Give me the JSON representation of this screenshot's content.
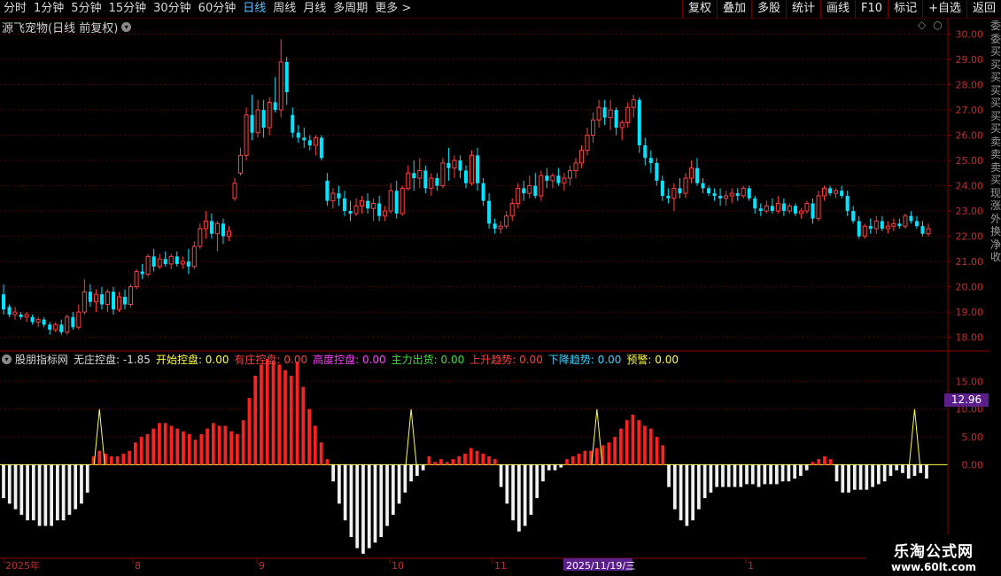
{
  "toolbar": {
    "periods": [
      "分时",
      "1分钟",
      "5分钟",
      "15分钟",
      "30分钟",
      "60分钟",
      "日线",
      "周线",
      "月线",
      "多周期",
      "更多 >"
    ],
    "active_period": "日线",
    "buttons": [
      "复权",
      "叠加",
      "多股",
      "统计",
      "画线",
      "F10",
      "标记",
      "+自选",
      "返回"
    ]
  },
  "chart_title": "源飞宠物(日线 前复权)",
  "price_axis": [
    "30.00",
    "29.00",
    "28.00",
    "27.00",
    "26.00",
    "25.00",
    "24.00",
    "23.00",
    "22.00",
    "21.00",
    "20.00",
    "19.00",
    "18.00"
  ],
  "indicator": {
    "name": "股朋指标网",
    "items": [
      {
        "label": "无庄控盘:",
        "value": "-1.85",
        "color": "#d8d8d8"
      },
      {
        "label": "开始控盘:",
        "value": "0.00",
        "color": "#ffff40"
      },
      {
        "label": "有庄控盘:",
        "value": "0.00",
        "color": "#ff4040"
      },
      {
        "label": "高度控盘:",
        "value": "0.00",
        "color": "#ff40ff"
      },
      {
        "label": "主力出货:",
        "value": "0.00",
        "color": "#40e040"
      },
      {
        "label": "上升趋势:",
        "value": "0.00",
        "color": "#ff4040"
      },
      {
        "label": "下降趋势:",
        "value": "0.00",
        "color": "#40d0ff"
      },
      {
        "label": "预警:",
        "value": "0.00",
        "color": "#ffff40"
      }
    ],
    "axis": [
      "15.00",
      "10.00",
      "5.00",
      "0.00"
    ],
    "current_value": "12.96"
  },
  "date_axis": [
    "2025年",
    "8",
    "9",
    "10",
    "11",
    "2025/11/19/三",
    "1"
  ],
  "right_strip": [
    "委",
    "委",
    "买",
    "买",
    "买",
    "买",
    "买",
    "买",
    "买",
    "卖",
    "卖",
    "卖",
    "买",
    "现",
    "涨",
    "外",
    "换",
    "净",
    "收"
  ],
  "watermark": {
    "line1": "乐淘公式网",
    "line2": "www.60lt.com"
  },
  "chart_data": [
    {
      "type": "candlestick",
      "title": "源飞宠物(日线 前复权)",
      "ylim": [
        17.6,
        30.3
      ],
      "colors": {
        "up": "#ff4040",
        "down": "#00e5ff"
      },
      "ohlc": [
        [
          19.7,
          20.1,
          18.9,
          19.1
        ],
        [
          19.2,
          19.3,
          18.8,
          18.9
        ],
        [
          18.9,
          19.2,
          18.7,
          19.0
        ],
        [
          18.9,
          19.0,
          18.7,
          18.8
        ],
        [
          18.8,
          19.0,
          18.6,
          18.9
        ],
        [
          18.8,
          18.9,
          18.5,
          18.6
        ],
        [
          18.6,
          18.8,
          18.4,
          18.7
        ],
        [
          18.7,
          18.8,
          18.4,
          18.5
        ],
        [
          18.5,
          18.6,
          18.1,
          18.3
        ],
        [
          18.3,
          18.6,
          18.2,
          18.5
        ],
        [
          18.5,
          18.7,
          18.1,
          18.2
        ],
        [
          18.2,
          18.9,
          18.1,
          18.8
        ],
        [
          18.8,
          19.0,
          18.3,
          18.4
        ],
        [
          18.4,
          19.3,
          18.3,
          19.0
        ],
        [
          19.0,
          20.3,
          18.9,
          19.8
        ],
        [
          19.8,
          20.1,
          19.2,
          19.4
        ],
        [
          19.4,
          19.9,
          19.0,
          19.7
        ],
        [
          19.7,
          20.0,
          19.1,
          19.3
        ],
        [
          19.3,
          19.9,
          19.0,
          19.8
        ],
        [
          19.8,
          20.0,
          18.9,
          19.1
        ],
        [
          19.1,
          19.8,
          19.0,
          19.6
        ],
        [
          19.6,
          19.9,
          19.1,
          19.3
        ],
        [
          19.3,
          20.1,
          19.2,
          20.0
        ],
        [
          20.0,
          20.7,
          19.9,
          20.6
        ],
        [
          20.6,
          20.9,
          20.3,
          20.5
        ],
        [
          20.5,
          21.3,
          20.4,
          21.2
        ],
        [
          21.2,
          21.5,
          20.6,
          20.8
        ],
        [
          20.8,
          21.3,
          20.7,
          21.1
        ],
        [
          21.1,
          21.4,
          20.8,
          20.9
        ],
        [
          20.9,
          21.3,
          20.7,
          21.2
        ],
        [
          21.2,
          21.4,
          20.8,
          20.9
        ],
        [
          20.9,
          21.2,
          20.7,
          21.0
        ],
        [
          21.0,
          21.5,
          20.5,
          20.8
        ],
        [
          20.8,
          21.8,
          20.7,
          21.6
        ],
        [
          21.6,
          22.5,
          21.5,
          22.3
        ],
        [
          22.3,
          23.0,
          21.9,
          22.6
        ],
        [
          22.6,
          22.9,
          21.9,
          22.1
        ],
        [
          22.1,
          22.6,
          21.4,
          22.5
        ],
        [
          22.5,
          22.7,
          21.7,
          22.0
        ],
        [
          22.0,
          22.4,
          21.8,
          22.2
        ],
        [
          23.5,
          24.3,
          23.4,
          24.1
        ],
        [
          24.5,
          25.5,
          24.4,
          25.2
        ],
        [
          25.2,
          27.1,
          25.0,
          26.8
        ],
        [
          26.8,
          27.6,
          25.8,
          26.1
        ],
        [
          26.1,
          27.4,
          25.9,
          27.0
        ],
        [
          27.0,
          27.4,
          25.9,
          26.3
        ],
        [
          26.3,
          27.5,
          26.0,
          27.3
        ],
        [
          27.3,
          28.3,
          26.9,
          27.0
        ],
        [
          27.0,
          29.8,
          26.7,
          28.9
        ],
        [
          28.9,
          29.1,
          27.2,
          27.7
        ],
        [
          26.8,
          27.1,
          25.9,
          26.1
        ],
        [
          26.1,
          26.4,
          25.7,
          25.9
        ],
        [
          25.9,
          26.3,
          25.5,
          25.8
        ],
        [
          25.8,
          26.0,
          25.4,
          25.6
        ],
        [
          25.6,
          26.0,
          25.2,
          25.9
        ],
        [
          25.9,
          26.0,
          25.0,
          25.1
        ],
        [
          24.2,
          24.5,
          23.2,
          23.4
        ],
        [
          23.4,
          23.9,
          23.1,
          23.7
        ],
        [
          23.7,
          24.0,
          23.2,
          23.5
        ],
        [
          23.5,
          23.8,
          22.8,
          23.0
        ],
        [
          23.0,
          23.4,
          22.6,
          22.9
        ],
        [
          22.9,
          23.5,
          22.8,
          23.2
        ],
        [
          23.2,
          23.6,
          22.9,
          23.4
        ],
        [
          23.4,
          23.7,
          22.9,
          23.1
        ],
        [
          23.1,
          23.5,
          22.6,
          23.3
        ],
        [
          23.3,
          23.6,
          22.6,
          22.8
        ],
        [
          22.8,
          23.2,
          22.6,
          23.0
        ],
        [
          23.0,
          24.1,
          22.9,
          23.8
        ],
        [
          23.8,
          24.2,
          22.7,
          22.9
        ],
        [
          22.9,
          24.0,
          22.8,
          23.9
        ],
        [
          23.9,
          24.8,
          23.8,
          24.5
        ],
        [
          24.5,
          25.0,
          23.8,
          24.3
        ],
        [
          24.3,
          25.1,
          23.9,
          24.6
        ],
        [
          24.6,
          24.8,
          23.7,
          23.9
        ],
        [
          23.9,
          24.5,
          23.6,
          24.3
        ],
        [
          24.3,
          24.5,
          23.8,
          24.0
        ],
        [
          24.0,
          25.1,
          23.9,
          24.9
        ],
        [
          24.9,
          25.5,
          24.2,
          24.7
        ],
        [
          24.7,
          25.2,
          24.3,
          25.0
        ],
        [
          25.0,
          25.2,
          24.3,
          24.6
        ],
        [
          24.6,
          24.8,
          23.9,
          24.1
        ],
        [
          24.1,
          25.4,
          24.0,
          25.2
        ],
        [
          25.2,
          25.5,
          23.8,
          24.1
        ],
        [
          24.1,
          24.3,
          23.2,
          23.4
        ],
        [
          23.4,
          23.7,
          22.3,
          22.5
        ],
        [
          22.5,
          22.7,
          22.1,
          22.3
        ],
        [
          22.3,
          22.6,
          22.1,
          22.4
        ],
        [
          22.4,
          23.0,
          22.3,
          22.8
        ],
        [
          22.8,
          23.5,
          22.6,
          23.3
        ],
        [
          23.3,
          24.1,
          23.1,
          23.9
        ],
        [
          23.9,
          24.2,
          23.4,
          23.7
        ],
        [
          23.7,
          24.4,
          23.5,
          24.0
        ],
        [
          24.0,
          24.5,
          23.5,
          23.6
        ],
        [
          23.6,
          24.6,
          23.4,
          24.4
        ],
        [
          24.4,
          24.7,
          23.9,
          24.2
        ],
        [
          24.2,
          24.5,
          23.9,
          24.4
        ],
        [
          24.4,
          24.7,
          24.0,
          24.1
        ],
        [
          24.1,
          24.5,
          23.8,
          24.3
        ],
        [
          24.3,
          24.8,
          24.0,
          24.6
        ],
        [
          24.6,
          25.1,
          24.3,
          24.9
        ],
        [
          24.9,
          25.6,
          24.7,
          25.4
        ],
        [
          25.4,
          26.3,
          25.2,
          26.0
        ],
        [
          26.0,
          26.9,
          25.7,
          26.6
        ],
        [
          26.6,
          27.4,
          26.3,
          27.1
        ],
        [
          27.1,
          27.4,
          26.4,
          26.7
        ],
        [
          26.7,
          27.4,
          26.2,
          27.0
        ],
        [
          27.0,
          27.1,
          26.0,
          26.3
        ],
        [
          26.3,
          26.6,
          25.8,
          26.5
        ],
        [
          26.5,
          27.3,
          26.3,
          27.1
        ],
        [
          27.1,
          27.6,
          26.7,
          27.4
        ],
        [
          27.4,
          27.5,
          25.3,
          25.6
        ],
        [
          25.6,
          25.9,
          24.8,
          25.1
        ],
        [
          25.1,
          25.4,
          24.5,
          24.9
        ],
        [
          24.9,
          25.1,
          24.0,
          24.2
        ],
        [
          24.2,
          24.4,
          23.4,
          23.6
        ],
        [
          23.6,
          23.9,
          23.3,
          23.5
        ],
        [
          23.5,
          24.1,
          23.0,
          23.9
        ],
        [
          23.9,
          24.3,
          23.5,
          23.7
        ],
        [
          23.7,
          24.5,
          23.5,
          24.3
        ],
        [
          24.3,
          25.0,
          24.1,
          24.7
        ],
        [
          24.7,
          25.1,
          24.0,
          24.1
        ],
        [
          24.1,
          24.3,
          23.7,
          23.9
        ],
        [
          23.9,
          24.0,
          23.6,
          23.7
        ],
        [
          23.7,
          23.9,
          23.4,
          23.6
        ],
        [
          23.6,
          23.9,
          23.2,
          23.5
        ],
        [
          23.5,
          23.8,
          23.2,
          23.6
        ],
        [
          23.6,
          23.9,
          23.3,
          23.7
        ],
        [
          23.7,
          23.9,
          23.4,
          23.6
        ],
        [
          23.6,
          24.0,
          23.5,
          23.9
        ],
        [
          23.9,
          24.0,
          23.4,
          23.5
        ],
        [
          23.5,
          23.6,
          22.9,
          23.1
        ],
        [
          23.1,
          23.3,
          22.8,
          23.0
        ],
        [
          23.0,
          23.4,
          22.9,
          23.2
        ],
        [
          23.2,
          23.5,
          22.9,
          23.0
        ],
        [
          23.0,
          23.6,
          22.9,
          23.3
        ],
        [
          23.3,
          23.5,
          22.8,
          23.0
        ],
        [
          23.0,
          23.3,
          22.9,
          23.2
        ],
        [
          23.2,
          23.3,
          22.8,
          22.9
        ],
        [
          22.9,
          23.1,
          22.7,
          23.0
        ],
        [
          23.0,
          23.4,
          22.9,
          23.3
        ],
        [
          23.3,
          23.5,
          22.5,
          22.7
        ],
        [
          22.7,
          23.8,
          22.6,
          23.6
        ],
        [
          23.6,
          24.0,
          23.4,
          23.9
        ],
        [
          23.9,
          24.0,
          23.6,
          23.7
        ],
        [
          23.7,
          23.9,
          23.5,
          23.8
        ],
        [
          23.8,
          24.0,
          23.5,
          23.6
        ],
        [
          23.6,
          23.8,
          22.8,
          23.0
        ],
        [
          23.0,
          23.2,
          22.5,
          22.6
        ],
        [
          22.6,
          22.8,
          21.9,
          22.0
        ],
        [
          22.0,
          22.5,
          21.9,
          22.4
        ],
        [
          22.4,
          22.7,
          22.1,
          22.3
        ],
        [
          22.3,
          22.8,
          22.1,
          22.6
        ],
        [
          22.6,
          22.8,
          22.2,
          22.3
        ],
        [
          22.3,
          22.6,
          22.1,
          22.4
        ],
        [
          22.4,
          22.7,
          22.2,
          22.5
        ],
        [
          22.5,
          22.7,
          22.3,
          22.4
        ],
        [
          22.4,
          22.9,
          22.3,
          22.8
        ],
        [
          22.8,
          23.0,
          22.5,
          22.6
        ],
        [
          22.6,
          22.8,
          22.3,
          22.4
        ],
        [
          22.4,
          22.6,
          22.0,
          22.1
        ],
        [
          22.1,
          22.5,
          22.0,
          22.3
        ]
      ]
    },
    {
      "type": "bar",
      "title": "股朋指标网",
      "ylim": [
        -16.5,
        19.5
      ],
      "yticks": [
        15,
        10,
        5,
        0
      ],
      "colors": {
        "up": "#ff2020",
        "down": "#f0f0f0",
        "mid": "#40e0c0",
        "warn": "#ffff40"
      },
      "values": [
        -6,
        -7,
        -8,
        -9,
        -10,
        -10,
        -11,
        -11,
        -11,
        -10,
        -10,
        -9,
        -8,
        -7,
        -5,
        1.5,
        2.5,
        2,
        1.5,
        1.5,
        2,
        2.5,
        4,
        5,
        5.5,
        6.5,
        7.5,
        7.5,
        7,
        6.5,
        6,
        5.5,
        4.5,
        5.5,
        6.5,
        7.5,
        7,
        7,
        6,
        5.5,
        8,
        12,
        16,
        18,
        19,
        18.5,
        18,
        17,
        16,
        18.5,
        14,
        10,
        7,
        4,
        1,
        -3,
        -7,
        -10,
        -13,
        -15,
        -16,
        -15,
        -14,
        -13,
        -11,
        -9,
        -7,
        -5,
        -3,
        -2,
        -1,
        1.5,
        0.5,
        1,
        0.5,
        1,
        1.5,
        2,
        3,
        2.5,
        2,
        1.5,
        1,
        -4,
        -7,
        -10,
        -12,
        -11,
        -9,
        -6,
        -3,
        -1,
        -1,
        -0.5,
        1,
        1.5,
        2,
        2.5,
        2.5,
        3,
        3.5,
        4,
        5,
        6.5,
        8,
        9,
        8,
        7,
        6.5,
        5,
        3.5,
        -4,
        -8,
        -10,
        -11,
        -10,
        -8,
        -6,
        -5,
        -4,
        -4,
        -4,
        -4,
        -4,
        -3.5,
        -3.5,
        -4,
        -3.5,
        -3.5,
        -3.5,
        -3,
        -3,
        -2.5,
        -2,
        -1,
        0.5,
        1.0,
        1.5,
        1.0,
        -3,
        -5,
        -5,
        -4.5,
        -4.5,
        -4.5,
        -4,
        -3.5,
        -3,
        -2,
        -1,
        -1.5,
        -2.5,
        -2,
        -1.5,
        -2.5
      ],
      "warnings": [
        16,
        68,
        99,
        152
      ]
    }
  ]
}
